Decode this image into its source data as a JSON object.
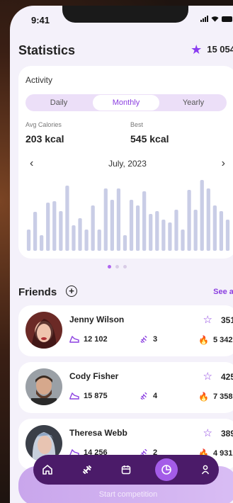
{
  "status": {
    "time": "9:41"
  },
  "header": {
    "title": "Statistics",
    "points": "15 054"
  },
  "activity": {
    "label": "Activity",
    "tabs": [
      "Daily",
      "Monthly",
      "Yearly"
    ],
    "active_tab": "Monthly",
    "avg_label": "Avg Calories",
    "avg_value": "203 kcal",
    "best_label": "Best",
    "best_value": "545 kcal",
    "month": "July, 2023",
    "bars": [
      0.3,
      0.55,
      0.22,
      0.68,
      0.7,
      0.56,
      0.92,
      0.36,
      0.46,
      0.3,
      0.64,
      0.3,
      0.88,
      0.72,
      0.88,
      0.22,
      0.72,
      0.64,
      0.84,
      0.52,
      0.56,
      0.44,
      0.4,
      0.58,
      0.3,
      0.86,
      0.58,
      1.0,
      0.88,
      0.64,
      0.56,
      0.44
    ]
  },
  "pager": {
    "count": 3,
    "active": 0
  },
  "friends": {
    "title": "Friends",
    "see_all": "See all",
    "items": [
      {
        "name": "Jenny Wilson",
        "score": "351",
        "steps": "12 102",
        "workouts": "3",
        "calories": "5 342"
      },
      {
        "name": "Cody Fisher",
        "score": "425",
        "steps": "15 875",
        "workouts": "4",
        "calories": "7 358"
      },
      {
        "name": "Theresa Webb",
        "score": "389",
        "steps": "14 256",
        "workouts": "2",
        "calories": "4 931"
      }
    ]
  },
  "nav": {
    "items": [
      "home-icon",
      "dumbbell-icon",
      "calendar-icon",
      "statistics-icon",
      "profile-icon"
    ],
    "active": "statistics-icon"
  },
  "cta": {
    "label": "Start competition"
  },
  "colors": {
    "accent": "#8b3fe0",
    "nav_bg": "#4b1b69",
    "bar": "#c9cde6"
  }
}
